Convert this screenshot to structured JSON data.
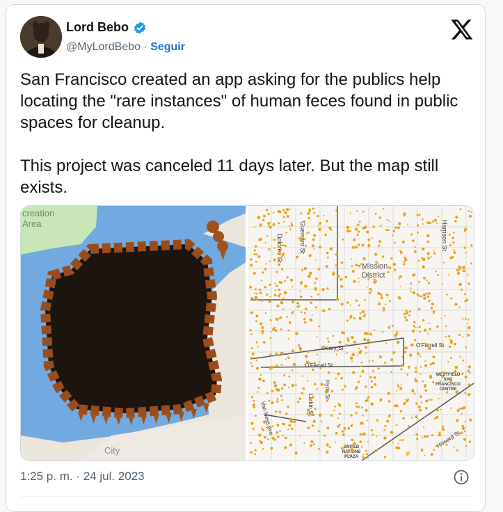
{
  "author": {
    "name": "Lord Bebo",
    "handle": "@MyLordBebo",
    "separator": " · ",
    "follow_label": "Seguir"
  },
  "post": {
    "text": "San Francisco created an app asking for the publics help locating the \"rare instances\" of human feces found in public spaces for cleanup.\n\nThis project was canceled 11 days later. But the map still exists.",
    "timestamp": "1:25 p. m. · 24 jul. 2023"
  },
  "map_left": {
    "area_label_1": "creation",
    "area_label_2": "Area",
    "city_label": "City"
  },
  "map_right": {
    "mission_1": "Mission",
    "mission_2": "District",
    "streets": {
      "dolores": "Dolores St",
      "guerrero": "Guerrero St",
      "harrison": "Harrison St",
      "geary": "Geary St",
      "ofarrell_a": "O'Farrell St",
      "ofarrell_b": "O'Farrell St",
      "hyde": "Hyde St",
      "larkin": "Larkin St",
      "van_ness": "Van Ness Ave",
      "howard": "Howard St"
    },
    "westfield": [
      "WESTFIELD",
      "SAN",
      "FRANCISCO",
      "CENTRE"
    ],
    "un_plaza": [
      "UNITED",
      "NATIONS",
      "PLAZA"
    ]
  },
  "colors": {
    "accent": "#1d9bf0",
    "pin": "#a0521d",
    "dot": "#e8a21c",
    "water": "#71a9e0"
  }
}
